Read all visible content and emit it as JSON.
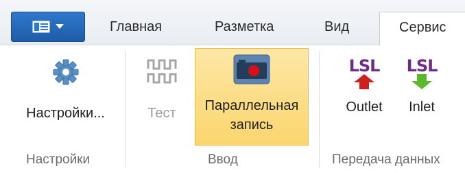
{
  "tabs": [
    {
      "label": "Главная"
    },
    {
      "label": "Разметка"
    },
    {
      "label": "Вид"
    },
    {
      "label": "Сервис"
    }
  ],
  "app_menu": {
    "icon": "ribbon-menu-icon",
    "arrow": "chevron-down-icon"
  },
  "groups": {
    "settings": {
      "label": "Настройки"
    },
    "input": {
      "label": "Ввод"
    },
    "transfer": {
      "label": "Передача данных"
    }
  },
  "buttons": {
    "settings": {
      "label": "Настройки...",
      "icon": "gear-icon"
    },
    "test": {
      "label": "Тест",
      "icon": "waveform-icon"
    },
    "parallel": {
      "label_line1": "Параллельная",
      "label_line2": "запись",
      "icon": "record-icon"
    },
    "outlet": {
      "label": "Outlet",
      "icon_text": "LSL",
      "icon": "lsl-outlet-icon"
    },
    "inlet": {
      "label": "Inlet",
      "icon_text": "LSL",
      "icon": "lsl-inlet-icon"
    }
  },
  "colors": {
    "accent": "#1d5ca8",
    "gear": "#5a8fc4",
    "selected_bg": "#fbd66e",
    "lsl_text": "#6d2b8c",
    "outlet_arrow": "#d11e1e",
    "inlet_arrow": "#5cb92c"
  }
}
